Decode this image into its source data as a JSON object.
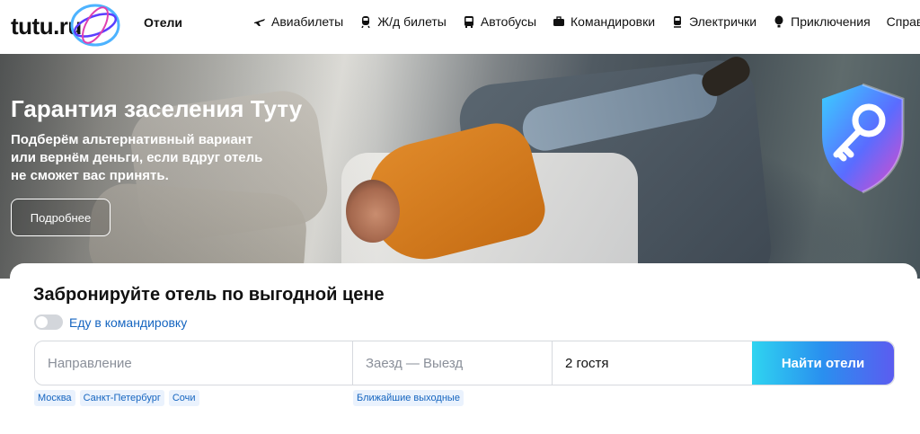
{
  "brand": {
    "logo_text": "tutu.ru",
    "section": "Отели"
  },
  "nav": [
    {
      "label": "Авиабилеты",
      "icon": "plane-icon"
    },
    {
      "label": "Ж/д билеты",
      "icon": "train-icon"
    },
    {
      "label": "Автобусы",
      "icon": "bus-icon"
    },
    {
      "label": "Командировки",
      "icon": "briefcase-icon"
    },
    {
      "label": "Электрички",
      "icon": "suburban-train-icon"
    },
    {
      "label": "Приключения",
      "icon": "balloon-icon"
    },
    {
      "label": "Справочная",
      "icon": ""
    }
  ],
  "hero": {
    "title": "Гарантия заселения Туту",
    "subtitle_lines": [
      "Подберём альтернативный вариант",
      "или вернём деньги, если вдруг отель",
      "не сможет вас принять."
    ],
    "button": "Подробнее"
  },
  "search": {
    "title": "Забронируйте отель по выгодной цене",
    "business_toggle_label": "Еду в командировку",
    "business_toggle_on": false,
    "destination_placeholder": "Направление",
    "dates_placeholder": "Заезд — Выезд",
    "guests_value": "2 гостя",
    "submit_label": "Найти отели",
    "city_suggestions": [
      "Москва",
      "Санкт-Петербург",
      "Сочи"
    ],
    "date_suggestions": [
      "Ближайшие выходные"
    ]
  },
  "colors": {
    "link": "#1565c0",
    "button_gradient": [
      "#2fd4f0",
      "#2a8fef",
      "#5b5cf0"
    ]
  }
}
